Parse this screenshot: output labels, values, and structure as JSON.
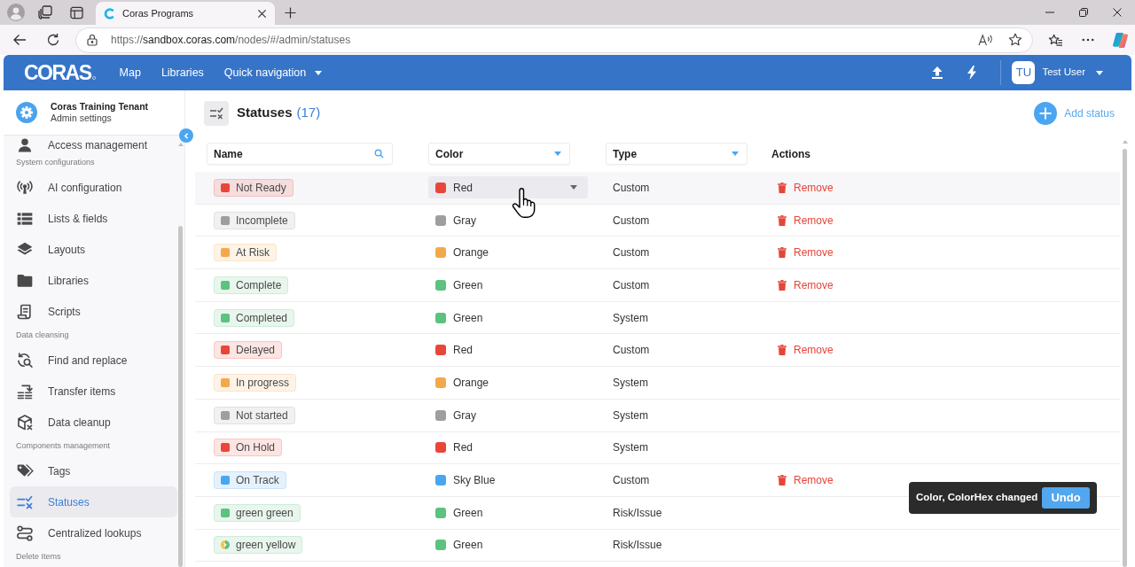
{
  "browser": {
    "tab": {
      "title": "Coras Programs"
    },
    "url": {
      "scheme": "https://",
      "host": "sandbox.coras.com",
      "path": "/nodes/#/admin/statuses"
    }
  },
  "app_header": {
    "logo": "CORAS",
    "nav": [
      {
        "label": "Map",
        "kind": "link"
      },
      {
        "label": "Libraries",
        "kind": "link"
      },
      {
        "label": "Quick navigation",
        "kind": "dropdown"
      }
    ],
    "user": {
      "initials": "TU",
      "name": "Test User"
    }
  },
  "sidebar": {
    "title": "Coras Training Tenant",
    "subtitle": "Admin settings",
    "groups": [
      {
        "items": [
          {
            "label": "Access management",
            "selected": false
          }
        ]
      },
      {
        "heading": "System configurations",
        "items": [
          {
            "label": "AI configuration",
            "selected": false
          },
          {
            "label": "Lists & fields",
            "selected": false
          },
          {
            "label": "Layouts",
            "selected": false
          },
          {
            "label": "Libraries",
            "selected": false
          },
          {
            "label": "Scripts",
            "selected": false
          }
        ]
      },
      {
        "heading": "Data cleansing",
        "items": [
          {
            "label": "Find and replace",
            "selected": false
          },
          {
            "label": "Transfer items",
            "selected": false
          },
          {
            "label": "Data cleanup",
            "selected": false
          }
        ]
      },
      {
        "heading": "Components management",
        "items": [
          {
            "label": "Tags",
            "selected": false
          },
          {
            "label": "Statuses",
            "selected": true
          },
          {
            "label": "Centralized lookups",
            "selected": false
          }
        ]
      },
      {
        "heading": "Delete Items"
      }
    ]
  },
  "page": {
    "title": "Statuses",
    "count": "(17)",
    "add_button": "Add status"
  },
  "table": {
    "columns": [
      {
        "label": "Name",
        "kind": "search"
      },
      {
        "label": "Color",
        "kind": "dropdown"
      },
      {
        "label": "Type",
        "kind": "dropdown"
      },
      {
        "label": "Actions",
        "kind": "plain"
      }
    ],
    "rows": [
      {
        "name": "Not Ready",
        "color": "#e9463a",
        "color_name": "Red",
        "type": "Custom",
        "action": "Remove",
        "hovered": true
      },
      {
        "name": "Incomplete",
        "color": "#9e9e9e",
        "color_name": "Gray",
        "type": "Custom",
        "action": "Remove",
        "hovered": false
      },
      {
        "name": "At Risk",
        "color": "#f4a84c",
        "color_name": "Orange",
        "type": "Custom",
        "action": "Remove",
        "hovered": false
      },
      {
        "name": "Complete",
        "color": "#5cc27f",
        "color_name": "Green",
        "type": "Custom",
        "action": "Remove",
        "hovered": false
      },
      {
        "name": "Completed",
        "color": "#5cc27f",
        "color_name": "Green",
        "type": "System",
        "hovered": false
      },
      {
        "name": "Delayed",
        "color": "#e9463a",
        "color_name": "Red",
        "type": "Custom",
        "action": "Remove",
        "hovered": false
      },
      {
        "name": "In progress",
        "color": "#f4a84c",
        "color_name": "Orange",
        "type": "System",
        "hovered": false
      },
      {
        "name": "Not started",
        "color": "#9e9e9e",
        "color_name": "Gray",
        "type": "System",
        "hovered": false
      },
      {
        "name": "On Hold",
        "color": "#e9463a",
        "color_name": "Red",
        "type": "System",
        "hovered": false
      },
      {
        "name": "On Track",
        "color": "#4aa6f1",
        "color_name": "Sky Blue",
        "type": "Custom",
        "action": "Remove",
        "hovered": false
      },
      {
        "name": "green green",
        "color": "#5cc27f",
        "color_name": "Green",
        "type": "Risk/Issue",
        "hovered": false
      },
      {
        "name": "green yellow",
        "color": "#5cc27f",
        "dot": [
          {
            "color": "#f2c14b"
          },
          {
            "color": "#5cc27f"
          }
        ],
        "color_name": "Green",
        "type": "Risk/Issue",
        "hovered": false
      }
    ]
  },
  "toast": {
    "message": "Color, ColorHex changed",
    "action": "Undo"
  }
}
